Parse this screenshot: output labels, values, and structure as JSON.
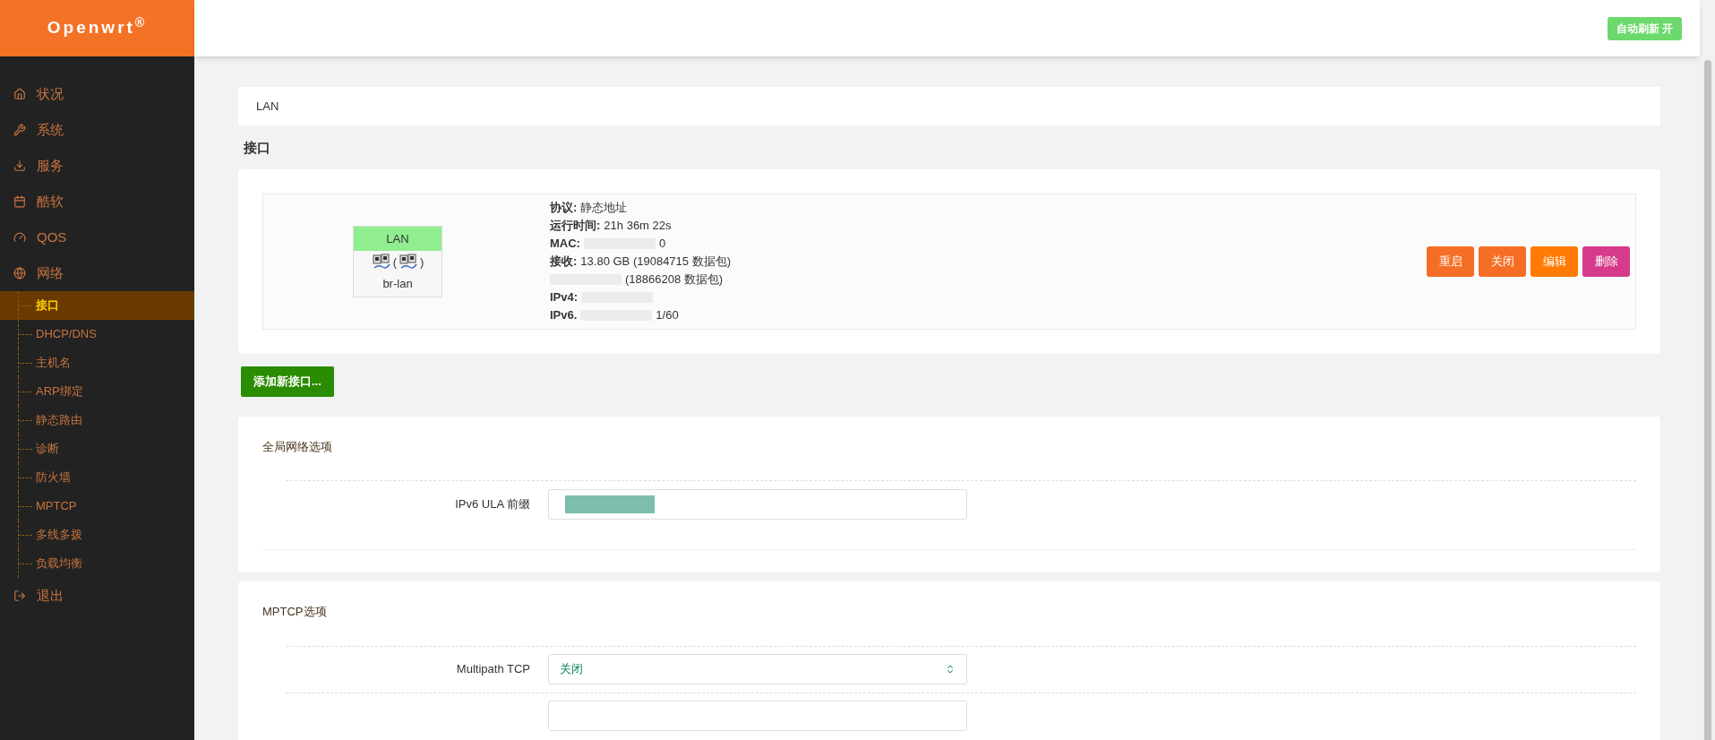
{
  "logo": {
    "text": "Openwrt",
    "mark": "®"
  },
  "nav": [
    {
      "label": "状况",
      "selected": false
    },
    {
      "label": "系统",
      "selected": false
    },
    {
      "label": "服务",
      "selected": false
    },
    {
      "label": "酷软",
      "selected": false
    },
    {
      "label": "QOS",
      "selected": false
    },
    {
      "label": "网络",
      "selected": false,
      "children": [
        {
          "label": "接口",
          "selected": true
        },
        {
          "label": "DHCP/DNS",
          "selected": false
        },
        {
          "label": "主机名",
          "selected": false
        },
        {
          "label": "ARP绑定",
          "selected": false
        },
        {
          "label": "静态路由",
          "selected": false
        },
        {
          "label": "诊断",
          "selected": false
        },
        {
          "label": "防火墙",
          "selected": false
        },
        {
          "label": "MPTCP",
          "selected": false
        },
        {
          "label": "多线多拨",
          "selected": false
        },
        {
          "label": "负载均衡",
          "selected": false
        }
      ]
    },
    {
      "label": "退出",
      "selected": false
    }
  ],
  "header": {
    "auto_refresh": "自动刷新 开"
  },
  "breadcrumb": "LAN",
  "section_title": "接口",
  "interface": {
    "name": "LAN",
    "color": "#90ee90",
    "device": "br-lan",
    "paren_open": "(",
    "paren_close": ")",
    "info": [
      {
        "label": "协议:",
        "value": "静态地址"
      },
      {
        "label": "运行时间:",
        "value": "21h 36m 22s"
      },
      {
        "label": "MAC:",
        "value": "0",
        "redacted": true
      },
      {
        "label": "接收:",
        "value": "13.80 GB (19084715 数据包)"
      },
      {
        "value": "(18866208 数据包)",
        "redacted": true
      },
      {
        "label": "IPv4:",
        "redacted": true
      },
      {
        "label": "IPv6.",
        "value": "1/60",
        "redacted": true
      }
    ],
    "buttons": [
      {
        "label": "重启",
        "color": "#f46f25"
      },
      {
        "label": "关闭",
        "color": "#f46f25"
      },
      {
        "label": "编辑",
        "color": "#ff7b05"
      },
      {
        "label": "删除",
        "color": "#d63a8a"
      }
    ]
  },
  "add_button": "添加新接口...",
  "sections": [
    {
      "title": "全局网络选项",
      "fields": [
        {
          "label": "IPv6 ULA 前缀",
          "kind": "text",
          "redacted": true
        }
      ]
    },
    {
      "title": "MPTCP选项",
      "fields": [
        {
          "label": "Multipath TCP",
          "kind": "select",
          "value": "关闭"
        },
        {
          "kind": "text"
        }
      ]
    }
  ]
}
